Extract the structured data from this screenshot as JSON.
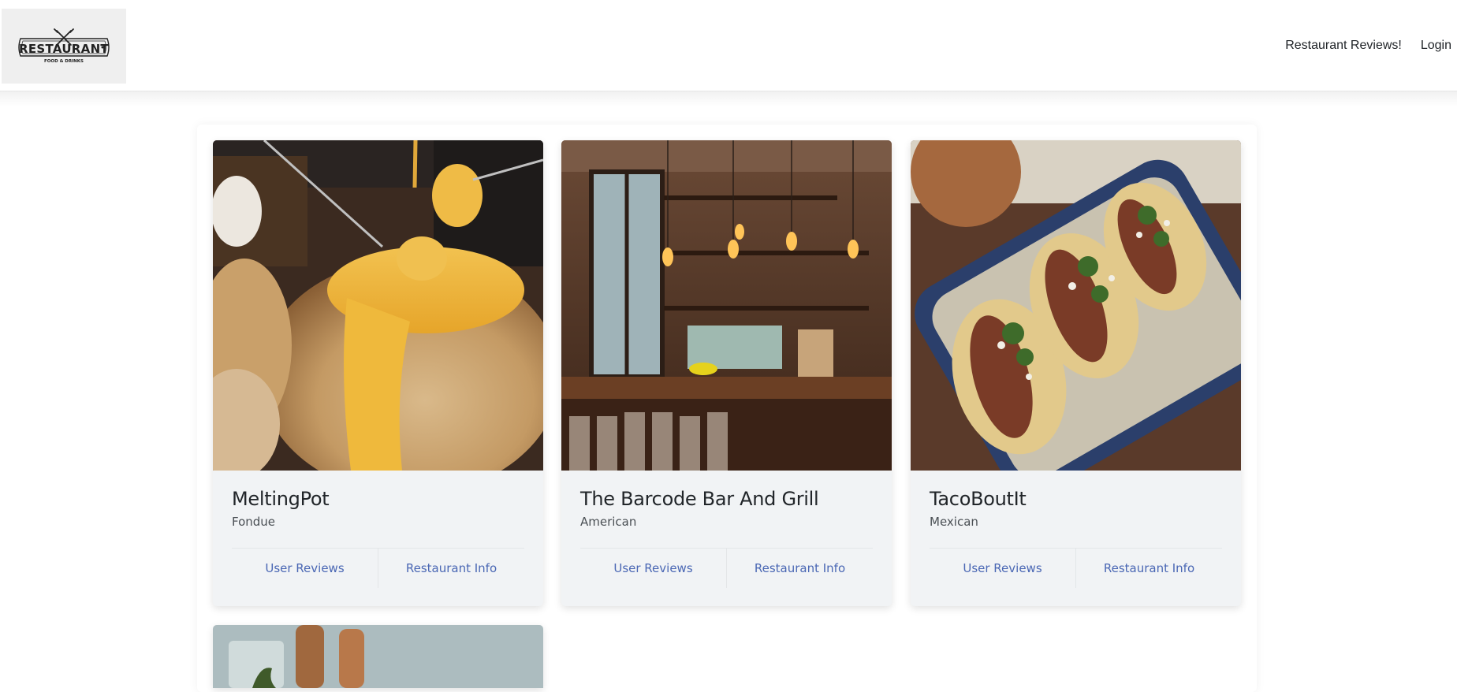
{
  "header": {
    "logo": {
      "wordmark": "RESTAURANT",
      "tagline": "FOOD & DRINKS"
    },
    "nav": [
      {
        "label": "Restaurant Reviews!"
      },
      {
        "label": "Login"
      }
    ]
  },
  "restaurants": [
    {
      "name": "MeltingPot",
      "cuisine": "Fondue",
      "image_icon": "fondue-photo",
      "actions": {
        "reviews": "User Reviews",
        "info": "Restaurant Info"
      }
    },
    {
      "name": "The Barcode Bar And Grill",
      "cuisine": "American",
      "image_icon": "bar-interior-photo",
      "actions": {
        "reviews": "User Reviews",
        "info": "Restaurant Info"
      }
    },
    {
      "name": "TacoBoutIt",
      "cuisine": "Mexican",
      "image_icon": "tacos-photo",
      "actions": {
        "reviews": "User Reviews",
        "info": "Restaurant Info"
      }
    }
  ],
  "colors": {
    "link": "#4a67b4",
    "card_bg": "#f1f3f5"
  }
}
